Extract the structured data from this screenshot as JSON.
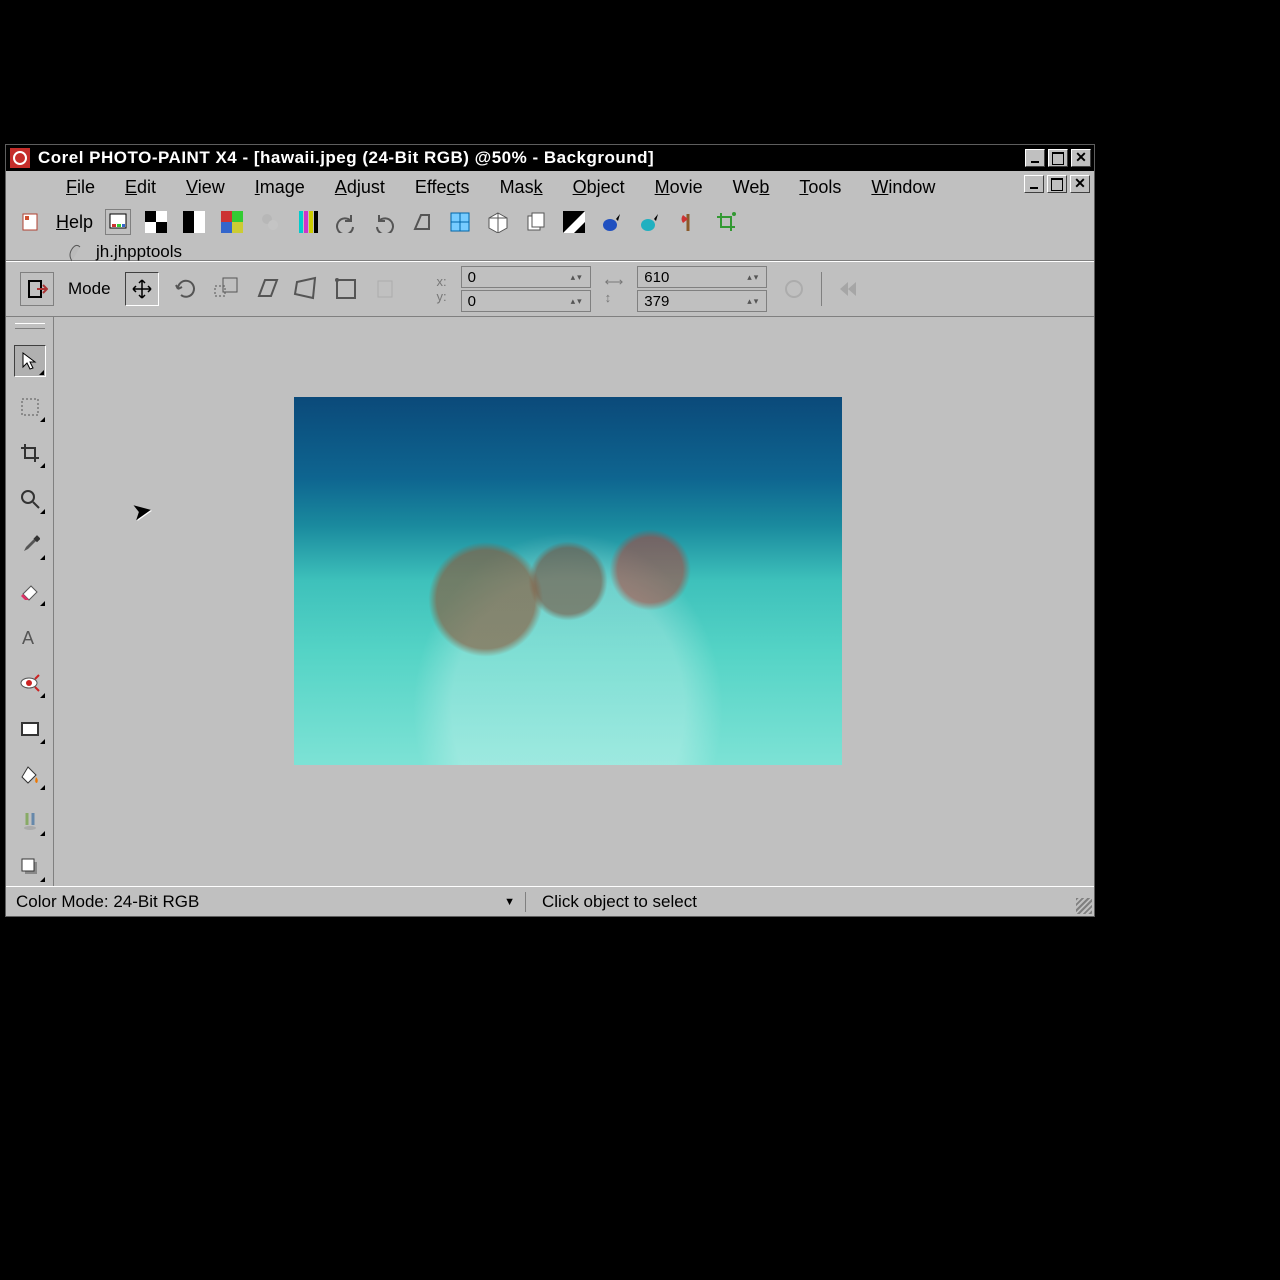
{
  "titlebar": {
    "text": "Corel PHOTO-PAINT X4 - [hawaii.jpeg (24-Bit RGB) @50% - Background]"
  },
  "menus": {
    "file": "File",
    "edit": "Edit",
    "view": "View",
    "image": "Image",
    "adjust": "Adjust",
    "effects": "Effects",
    "mask": "Mask",
    "object": "Object",
    "movie": "Movie",
    "web": "Web",
    "tools": "Tools",
    "window": "Window",
    "help": "Help"
  },
  "document_tab": "jh.jhpptools",
  "propbar": {
    "mode_label": "Mode",
    "pos_x": "0",
    "pos_y": "0",
    "size_w": "610",
    "size_h": "379"
  },
  "status": {
    "color_mode": "Color Mode: 24-Bit RGB",
    "hint": "Click object to select"
  }
}
